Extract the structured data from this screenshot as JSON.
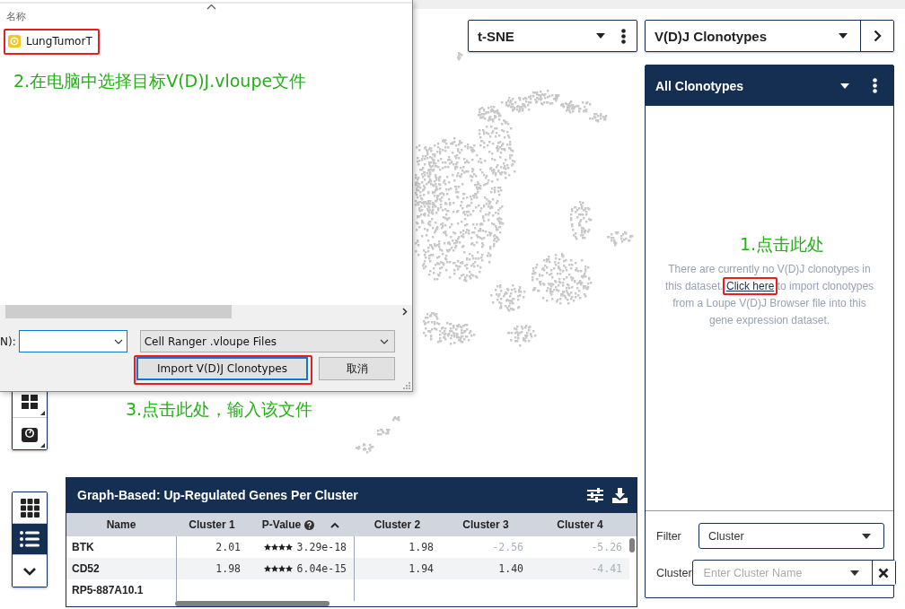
{
  "projection_dropdown": {
    "value": "t-SNE"
  },
  "view_buttons": [
    {
      "kind": "grid",
      "selected": false
    },
    {
      "kind": "list",
      "selected": true
    },
    {
      "kind": "collapse",
      "selected": false
    }
  ],
  "table": {
    "title": "Graph-Based: Up-Regulated Genes Per Cluster",
    "columns": [
      {
        "label": "Name"
      },
      {
        "label": "Cluster 1"
      },
      {
        "label": "P-Value",
        "help": true,
        "sort_ascending": true
      },
      {
        "label": "Cluster 2"
      },
      {
        "label": "Cluster 3"
      },
      {
        "label": "Cluster 4"
      }
    ],
    "rows": [
      {
        "name": "BTK",
        "cluster_1": "2.01",
        "stars": 4,
        "p_value": "3.29e-18",
        "others": [
          {
            "value": "1.98",
            "faded": false
          },
          {
            "value": "-2.56",
            "faded": true
          },
          {
            "value": "-5.26",
            "faded": true
          }
        ]
      },
      {
        "name": "CD52",
        "cluster_1": "1.98",
        "stars": 4,
        "p_value": "6.04e-15",
        "others": [
          {
            "value": "1.94",
            "faded": false
          },
          {
            "value": "1.40",
            "faded": false
          },
          {
            "value": "-4.41",
            "faded": true
          }
        ]
      },
      {
        "name": "RP5-887A10.1"
      }
    ]
  },
  "feature_dropdown": {
    "value": "V(D)J Clonotypes"
  },
  "clonotype_panel": {
    "title": "All Clonotypes",
    "message_before": "There are currently no V(D)J clonotypes in this dataset.",
    "link": "Click here",
    "message_after": "to import clonotypes from a Loupe V(D)J Browser file into this gene expression dataset.",
    "filters": [
      {
        "label": "Filter",
        "kind": "select",
        "value": "Cluster"
      },
      {
        "label": "Cluster",
        "kind": "search",
        "placeholder": "Enter Cluster Name"
      }
    ]
  },
  "file_dialog": {
    "column_header": "名称",
    "files": [
      {
        "name": "LungTumorT"
      }
    ],
    "filename_label": "N):",
    "file_type": "Cell Ranger .vloupe Files",
    "buttons": [
      {
        "label": "Import V(D)J Clonotypes",
        "default": true
      },
      {
        "label": "取消",
        "default": false
      }
    ]
  },
  "annotations": [
    {
      "text": "2.在电脑中选择目标V(D)J.vloupe文件"
    },
    {
      "text": "3.点击此处，输入该文件"
    },
    {
      "text": "1.点击此处"
    }
  ]
}
